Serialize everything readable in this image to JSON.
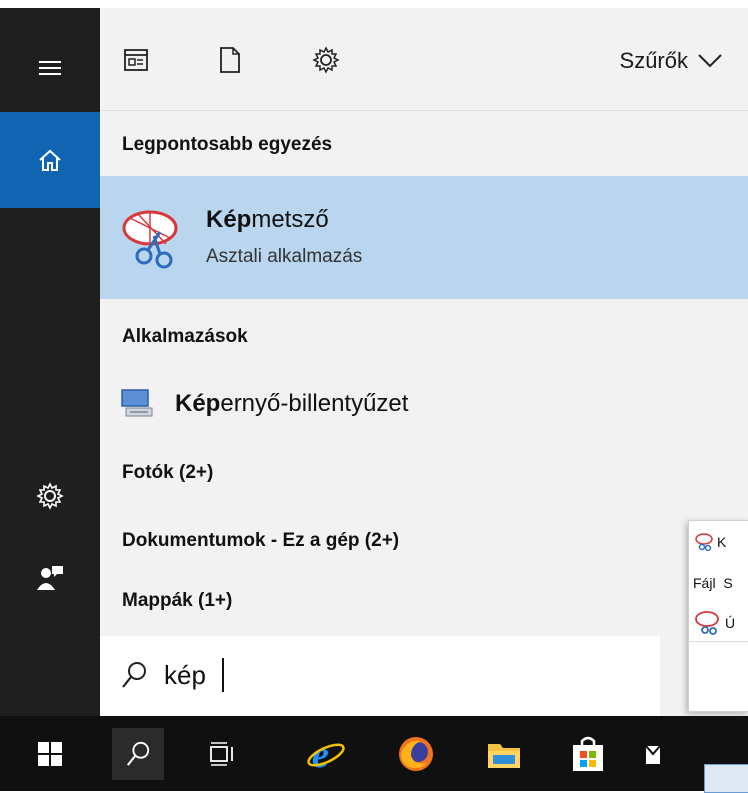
{
  "toolbar": {
    "filters_label": "Szűrők"
  },
  "best_match": {
    "header": "Legpontosabb egyezés",
    "app_name_bold": "Kép",
    "app_name_rest": "metsző",
    "app_type": "Asztali alkalmazás"
  },
  "apps": {
    "header": "Alkalmazások",
    "items": [
      {
        "name_bold": "Kép",
        "name_rest": "ernyő-billentyűzet"
      }
    ]
  },
  "categories": [
    "Fotók (2+)",
    "Dokumentumok - Ez a gép (2+)",
    "Mappák (1+)"
  ],
  "search": {
    "value": "kép"
  },
  "background_window": {
    "title_fragment": "K",
    "menu_fragment": "Fájl  S",
    "toolbar_fragment": "Ú"
  },
  "colors": {
    "selection": "#b9d6ee",
    "rail": "#1f1f1f",
    "rail_active": "#1064b2",
    "taskbar": "#101010"
  }
}
